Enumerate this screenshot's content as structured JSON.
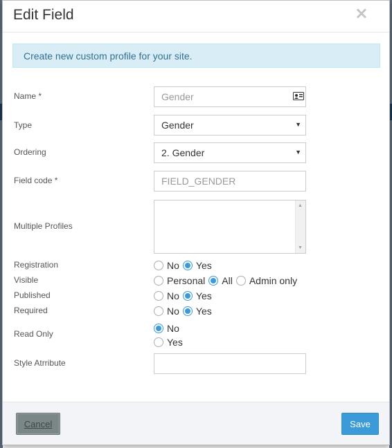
{
  "modal": {
    "title": "Edit Field",
    "close_label": "×",
    "alert_text": "Create new custom profile for your site."
  },
  "form": {
    "name": {
      "label": "Name *",
      "value": "Gender",
      "icon": "contact-card-icon"
    },
    "type": {
      "label": "Type",
      "value": "Gender"
    },
    "ordering": {
      "label": "Ordering",
      "value": "2. Gender"
    },
    "field_code": {
      "label": "Field code *",
      "value": "FIELD_GENDER"
    },
    "multiple_profiles": {
      "label": "Multiple Profiles",
      "value": ""
    },
    "registration": {
      "label": "Registration",
      "options": [
        "No",
        "Yes"
      ],
      "selected": "Yes"
    },
    "visible": {
      "label": "Visible",
      "options": [
        "Personal",
        "All",
        "Admin only"
      ],
      "selected": "All"
    },
    "published": {
      "label": "Published",
      "options": [
        "No",
        "Yes"
      ],
      "selected": "Yes"
    },
    "required": {
      "label": "Required",
      "options": [
        "No",
        "Yes"
      ],
      "selected": "Yes"
    },
    "read_only": {
      "label": "Read Only",
      "options": [
        "No",
        "Yes"
      ],
      "selected": "No"
    },
    "style_attribute": {
      "label": "Style Atrribute",
      "value": ""
    }
  },
  "footer": {
    "cancel_label": "Cancel",
    "save_label": "Save"
  },
  "colors": {
    "accent": "#3c9ad9",
    "alert_bg": "#d9edf7",
    "alert_text": "#31708f",
    "cancel_bg": "#7b8787"
  }
}
